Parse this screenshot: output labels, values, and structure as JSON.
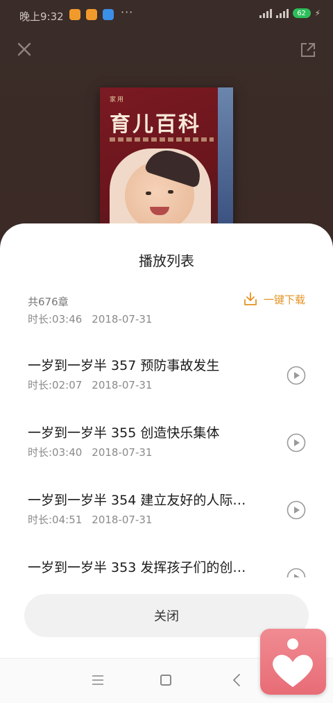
{
  "status": {
    "time": "晚上9:32",
    "dots": "···",
    "battery": "62",
    "app_icon_colors": [
      "#f19a2c",
      "#f19a2c",
      "#3b8fe6"
    ]
  },
  "player": {
    "cover_title": "育儿百科",
    "cover_subtitle": "家用"
  },
  "sheet": {
    "title": "播放列表",
    "count": "共676章",
    "download_label": "一键下载",
    "accent_color": "#e39322"
  },
  "partial_item": {
    "duration": "时长:03:46",
    "date": "2018-07-31"
  },
  "items": [
    {
      "title": "一岁到一岁半 357 预防事故发生",
      "duration": "时长:02:07",
      "date": "2018-07-31"
    },
    {
      "title": "一岁到一岁半 355 创造快乐集体",
      "duration": "时长:03:40",
      "date": "2018-07-31"
    },
    {
      "title": "一岁到一岁半 354 建立友好的人际…",
      "duration": "时长:04:51",
      "date": "2018-07-31"
    },
    {
      "title": "一岁到一岁半 353 发挥孩子们的创…",
      "duration": "",
      "date": ""
    }
  ],
  "close_button": "关闭",
  "icons": [
    "close-icon",
    "share-icon",
    "download-icon",
    "play-icon",
    "menu-icon",
    "home-icon",
    "back-icon",
    "heart-app-icon"
  ]
}
